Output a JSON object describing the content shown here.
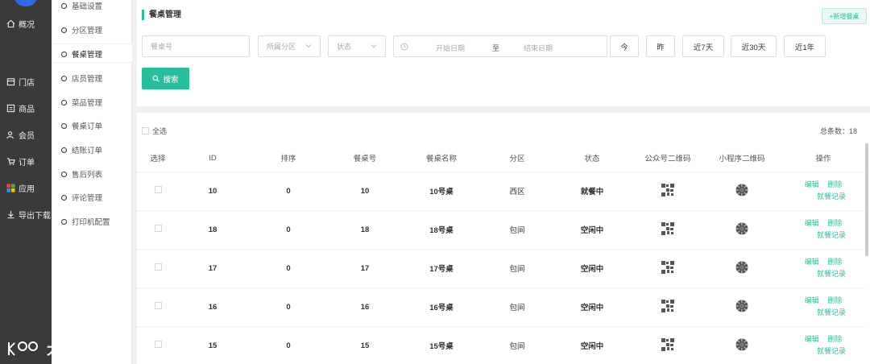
{
  "nav1": {
    "overview": "概况",
    "store": "门店",
    "goods": "商品",
    "member": "会员",
    "orders": "订单",
    "apps": "应用",
    "export": "导出下载"
  },
  "nav2": [
    "基础设置",
    "分区管理",
    "餐桌管理",
    "店员管理",
    "菜品管理",
    "餐桌订单",
    "结账订单",
    "售后列表",
    "评论管理",
    "打印机配置"
  ],
  "header": {
    "title": "餐桌管理",
    "add_button": "+新增餐桌"
  },
  "filters": {
    "table_no_placeholder": "餐桌号",
    "zone_placeholder": "所属分区",
    "status_placeholder": "状态",
    "start_date_placeholder": "开始日期",
    "to": "至",
    "end_date_placeholder": "结束日期",
    "quick": [
      "今",
      "昨",
      "近7天",
      "近30天",
      "近1年"
    ],
    "search_button": "搜索"
  },
  "list": {
    "select_all": "全选",
    "total": "总条数：18",
    "columns": [
      "选择",
      "ID",
      "排序",
      "餐桌号",
      "餐桌名称",
      "分区",
      "状态",
      "公众号二维码",
      "小程序二维码",
      "操作"
    ],
    "rows": [
      {
        "id": "10",
        "sort": "0",
        "table_no": "10",
        "name": "10号桌",
        "zone": "西区",
        "status": "就餐中"
      },
      {
        "id": "18",
        "sort": "0",
        "table_no": "18",
        "name": "18号桌",
        "zone": "包间",
        "status": "空闲中"
      },
      {
        "id": "17",
        "sort": "0",
        "table_no": "17",
        "name": "17号桌",
        "zone": "包间",
        "status": "空闲中"
      },
      {
        "id": "16",
        "sort": "0",
        "table_no": "16",
        "name": "16号桌",
        "zone": "包间",
        "status": "空闲中"
      },
      {
        "id": "15",
        "sort": "0",
        "table_no": "15",
        "name": "15号桌",
        "zone": "包间",
        "status": "空闲中"
      }
    ],
    "actions": {
      "edit": "编辑",
      "delete": "删除",
      "records": "就餐记录"
    }
  },
  "watermark": "大数跨境",
  "colors": {
    "accent": "#27bf9a",
    "nav_bg": "#3a3a3a"
  }
}
